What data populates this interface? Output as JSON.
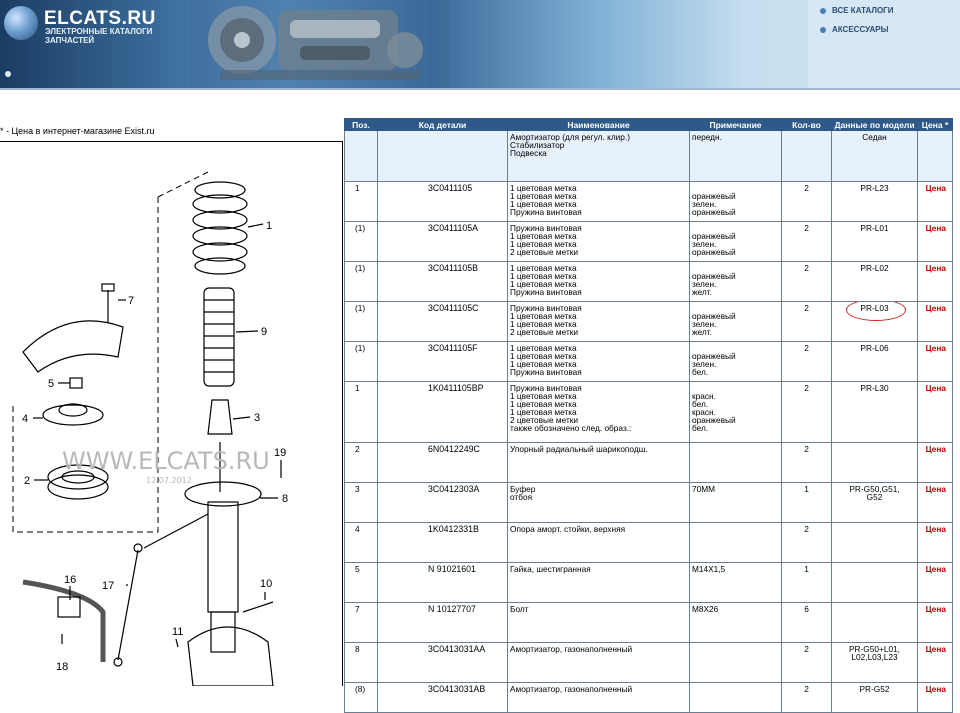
{
  "header": {
    "site_title": "ELCATS.RU",
    "site_subtitle_1": "ЭЛЕКТРОННЫЕ КАТАЛОГИ",
    "site_subtitle_2": "ЗАПЧАСТЕЙ",
    "nav": [
      "ВСЕ КАТАЛОГИ",
      "АКСЕССУАРЫ"
    ]
  },
  "note": "* - Цена в интернет-магазине Exist.ru",
  "diagram": {
    "watermark": "WWW.ELCATS.RU",
    "watermark_date": "12.07.2012",
    "callouts": [
      "1",
      "9",
      "3",
      "7",
      "5",
      "4",
      "2",
      "19",
      "8",
      "17",
      "16",
      "10",
      "11",
      "18"
    ]
  },
  "table": {
    "columns": [
      "Поз.",
      "Код детали",
      "Наименование",
      "Примечание",
      "Кол-во",
      "Данные по модели",
      "Цена *"
    ],
    "price_label": "Цена",
    "header_row": {
      "names": [
        "Амортизатор (для регул. клир.)",
        "Стабилизатор",
        "Подвеска"
      ],
      "note": "передн.",
      "model": "Седан"
    },
    "rows": [
      {
        "pos": "1",
        "code": "3C0411105",
        "names": [
          "1 цветовая метка",
          "1 цветовая метка",
          "1 цветовая метка",
          "Пружина винтовая"
        ],
        "notes": [
          "",
          "оранжевый",
          "зелен.",
          "оранжевый"
        ],
        "qty": "2",
        "model": [
          "PR-L23"
        ]
      },
      {
        "pos": "(1)",
        "code": "3C0411105A",
        "names": [
          "Пружина винтовая",
          "1 цветовая метка",
          "1 цветовая метка",
          "2 цветовые метки"
        ],
        "notes": [
          "",
          "оранжевый",
          "зелен.",
          "оранжевый"
        ],
        "qty": "2",
        "model": [
          "PR-L01"
        ]
      },
      {
        "pos": "(1)",
        "code": "3C0411105B",
        "names": [
          "1 цветовая метка",
          "1 цветовая метка",
          "1 цветовая метка",
          "Пружина винтовая"
        ],
        "notes": [
          "",
          "оранжевый",
          "зелен.",
          "желт."
        ],
        "qty": "2",
        "model": [
          "PR-L02"
        ]
      },
      {
        "pos": "(1)",
        "code": "3C0411105C",
        "names": [
          "Пружина винтовая",
          "1 цветовая метка",
          "1 цветовая метка",
          "2 цветовые метки"
        ],
        "notes": [
          "",
          "оранжевый",
          "зелен.",
          "желт."
        ],
        "qty": "2",
        "model": [
          "PR-L03"
        ]
      },
      {
        "pos": "(1)",
        "code": "3C0411105F",
        "names": [
          "1 цветовая метка",
          "1 цветовая метка",
          "1 цветовая метка",
          "Пружина винтовая"
        ],
        "notes": [
          "",
          "оранжевый",
          "зелен.",
          "бел."
        ],
        "qty": "2",
        "model": [
          "PR-L06"
        ]
      },
      {
        "pos": "1",
        "code": "1K0411105BP",
        "names": [
          "Пружина винтовая",
          "1 цветовая метка",
          "1 цветовая метка",
          "1 цветовая метка",
          "2 цветовые метки",
          "также обозначено след. образ.:"
        ],
        "notes": [
          "",
          "красн.",
          "бел.",
          "красн.",
          "оранжевый",
          "бел."
        ],
        "qty": "2",
        "model": [
          "PR-L30"
        ]
      },
      {
        "pos": "2",
        "code": "6N0412249C",
        "names": [
          "Упорный радиальный шарикоподш."
        ],
        "notes": [
          ""
        ],
        "qty": "2",
        "model": [
          ""
        ]
      },
      {
        "pos": "3",
        "code": "3C0412303A",
        "names": [
          "Буфер",
          "отбоя"
        ],
        "notes": [
          "70MM"
        ],
        "qty": "1",
        "model": [
          "PR-G50,G51,",
          "G52"
        ]
      },
      {
        "pos": "4",
        "code": "1K0412331B",
        "names": [
          "Опора аморт. стойки, верхняя"
        ],
        "notes": [
          ""
        ],
        "qty": "2",
        "model": [
          ""
        ]
      },
      {
        "pos": "5",
        "code": "N  91021601",
        "names": [
          "Гайка, шестигранная"
        ],
        "notes": [
          "M14X1,5"
        ],
        "qty": "1",
        "model": [
          ""
        ]
      },
      {
        "pos": "7",
        "code": "N  10127707",
        "names": [
          "Болт"
        ],
        "notes": [
          "M8X26"
        ],
        "qty": "6",
        "model": [
          ""
        ]
      },
      {
        "pos": "8",
        "code": "3C0413031AA",
        "names": [
          "Амортизатор, газонаполненный"
        ],
        "notes": [
          ""
        ],
        "qty": "2",
        "model": [
          "PR-G50+L01,",
          "L02,L03,L23"
        ]
      },
      {
        "pos": "(8)",
        "code": "3C0413031AB",
        "names": [
          "Амортизатор, газонаполненный"
        ],
        "notes": [
          ""
        ],
        "qty": "2",
        "model": [
          "PR-G52"
        ]
      }
    ]
  },
  "colors": {
    "table_header_bg": "#2f5989",
    "price_red": "#c00000",
    "highlight_circle": "#d62020"
  }
}
